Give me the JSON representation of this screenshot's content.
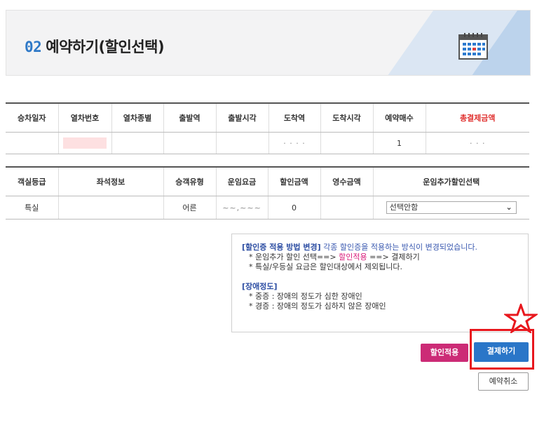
{
  "header": {
    "step_number": "02",
    "title": "예약하기(할인선택)",
    "calendar_icon": "calendar-icon"
  },
  "trip_table": {
    "headers": [
      "승차일자",
      "열차번호",
      "열차종별",
      "출발역",
      "출발시각",
      "도착역",
      "도착시각",
      "예약매수",
      "총결제금액"
    ],
    "row": [
      "",
      "",
      "",
      "",
      "",
      "· · · ·",
      "",
      "1",
      "·      ·  ·"
    ]
  },
  "fare_table": {
    "headers": [
      "객실등급",
      "좌석정보",
      "승객유형",
      "운임요금",
      "할인금액",
      "영수금액",
      "운임추가할인선택"
    ],
    "row": [
      "특실",
      "",
      "어른",
      "~~,~~~",
      "0",
      "",
      ""
    ],
    "discount_select": {
      "selected": "선택안함",
      "arrow": "chevron-down-icon"
    }
  },
  "notice": {
    "line1_heading": "[할인증 적용 방법 변경]",
    "line1_text": " 각종 할인증을 적용하는 방식이 변경되었습니다.",
    "line2_a": "* 운임추가 할인 선택==> ",
    "line2_b": "할인적용",
    "line2_c": " ==> 결제하기",
    "line3": "* 특실/우등실 요금은 할인대상에서 제외됩니다.",
    "section2_heading": "[장애정도]",
    "line4": "* 중증 : 장애의 정도가 심한 장애인",
    "line5": "* 경증 : 장애의 정도가 심하지 않은 장애인"
  },
  "buttons": {
    "discount": "할인적용",
    "pay": "결제하기",
    "cancel": "예약취소"
  },
  "colors": {
    "accent_blue": "#2a76c8",
    "discount_pink": "#cc2b76",
    "highlight_red": "#e8171d",
    "total_red": "#e0312f"
  }
}
